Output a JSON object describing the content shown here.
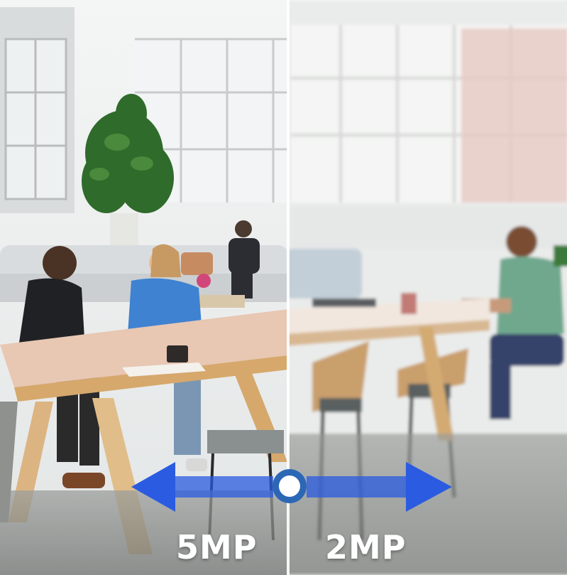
{
  "comparison": {
    "left_label": "5MP",
    "right_label": "2MP"
  },
  "colors": {
    "arrow": "#2a5be0",
    "handle_ring": "#2c67b5",
    "handle_fill": "#ffffff",
    "divider": "#ffffff"
  },
  "icons": {
    "left": "arrow-left-icon",
    "right": "arrow-right-icon",
    "handle": "slider-handle-icon"
  }
}
